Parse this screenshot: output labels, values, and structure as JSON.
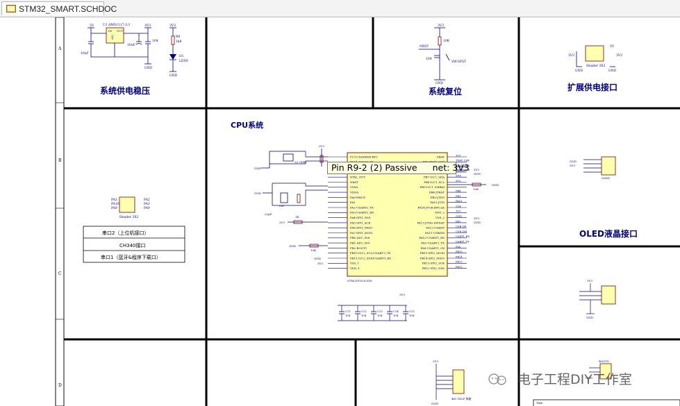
{
  "tab": {
    "title": "STM32_SMART.SCHDOC",
    "icon": "schematic-document-icon"
  },
  "border": {
    "zones": [
      "A",
      "B",
      "C",
      "D"
    ]
  },
  "sections": {
    "power_regulator": "系统供电稳压",
    "system_reset": "系统复位",
    "expansion_power": "扩展供电接口",
    "cpu_system": "CPU系统",
    "oled": "OLED液晶接口"
  },
  "regulator": {
    "u1_label": "U1 AMS1117-3.3",
    "in_pin": "IN",
    "out_pin": "OUT",
    "adj_pin": "ADJ",
    "c_in": "10uF",
    "c_out": "10uF",
    "c_104": "104",
    "net_5v": "5V",
    "net_3v3": "3V3",
    "gnd": "GND",
    "r8": "R8",
    "r8_value": "1k8",
    "led": "D1",
    "led_value": "LED0"
  },
  "reset": {
    "net_3v3": "3V3",
    "r_value": "10K",
    "nrst": "NRST",
    "cap": "104",
    "switch": "SW-SPST",
    "gnd": "GND"
  },
  "expansion": {
    "net_3v3_left": "3V3",
    "net_5v": "5V",
    "net_3v3_right": "3V3",
    "connector": "Header 3X2",
    "gnd": "GND"
  },
  "uart_header": {
    "connector": "Header 3X2",
    "pins_left": [
      "PA3",
      "PA10",
      "PA9"
    ],
    "pins_right": [
      "PA2",
      "PA3",
      "PA9"
    ]
  },
  "uart_box": {
    "row1": "串口2（上位机接口）",
    "row2": "CH340接口",
    "row3": "串口1（蓝牙&程序下载口）"
  },
  "mcu": {
    "part": "STM32F103C8T6",
    "left_pins": [
      "PC13-TAMPER-RTC",
      "PC14-OSC32_IN",
      "PC15-OSC32_OUT",
      "XTAL_IN",
      "XTAL_OUT",
      "NRST",
      "VSSA",
      "VDDA",
      "PA0-WKUP",
      "PA1",
      "PA2-USART2_TX",
      "PA3-USART2_RX",
      "PA4-SPI1_NSS",
      "PA5-SPI1_SCK",
      "PA6-SPI1_MISO",
      "PA7-SPI1_MOSI",
      "PB0-ADC_IN8",
      "PB1-ADC_IN9",
      "PB2-BOOT1",
      "PB10-I2C2_SCL/USART3_TX",
      "PB11-I2C2_SDA/USART3_RX",
      "VSS_1",
      "VDD_1"
    ],
    "right_pins": [
      "VBAT",
      "PB9-TIM4_CH4",
      "PB8-TIM4_CH3",
      "BOOT0",
      "PB7-I2C1_SDA",
      "PB6-I2C1_SCL",
      "PB5-I2C1_SMBAI",
      "PB4-JTRST",
      "PB3-JTDO",
      "PA15-JTDI",
      "PA14-JTCK-SWCLK",
      "VDD_2",
      "VSS_2",
      "PA13-JTMS-SWDAT",
      "PA12-USBDP",
      "PA11-USBDM",
      "PA10-USART1_RX",
      "PA9-USART1_TX",
      "PA8-USART1_CK",
      "PB15-SPI2_MOSI",
      "PB14-SPI2_MISO",
      "PB13-SPI2_SCK",
      "PB12-SPI2_NSS"
    ],
    "right_nets": [
      "3V3",
      "TIM4_CH4",
      "TIM4_CH3",
      "BOOT0",
      "SDA",
      "SCL",
      "",
      "PB4",
      "PB3",
      "PA15",
      "CLK",
      "3V3",
      "GND",
      "DIO",
      "USB_DP",
      "USB_DM",
      "UART1_RX",
      "UART1_TX",
      "PA8",
      "PB15",
      "PB14",
      "PB13",
      "PB12"
    ],
    "crystal_32k": "32.768K",
    "crystal_8m": "8M",
    "cap_22p": "22pF",
    "r_10k": "10K",
    "r_1k": "1K",
    "gnd": "GND",
    "net_3v3": "3V3",
    "cap_104": "104"
  },
  "decoupling": {
    "caps": [
      "C11",
      "C12",
      "C13",
      "C14",
      "C15"
    ],
    "value": "104",
    "net_3v3": "3V3",
    "gnd": "GND"
  },
  "oled_header": {
    "net": "GND",
    "net2": "3V3",
    "label": "OLED"
  },
  "bottom": {
    "boot": "BOOT0",
    "r": "RP",
    "gnd": "GND",
    "net_3v3": "3V3",
    "connector_label": "4x1.0X2P 排座"
  },
  "title_block": {
    "title": "Title"
  },
  "tooltip": {
    "pin": "Pin R9-2 (2) Passive",
    "net": "net: 3V3"
  },
  "watermark": {
    "text": "电子工程DIY工作室"
  },
  "colors": {
    "wire": "#000080",
    "border": "#000000",
    "title": "#000080",
    "component_fill": "#ffffb0",
    "tooltip_bg": "#ffffe1"
  }
}
